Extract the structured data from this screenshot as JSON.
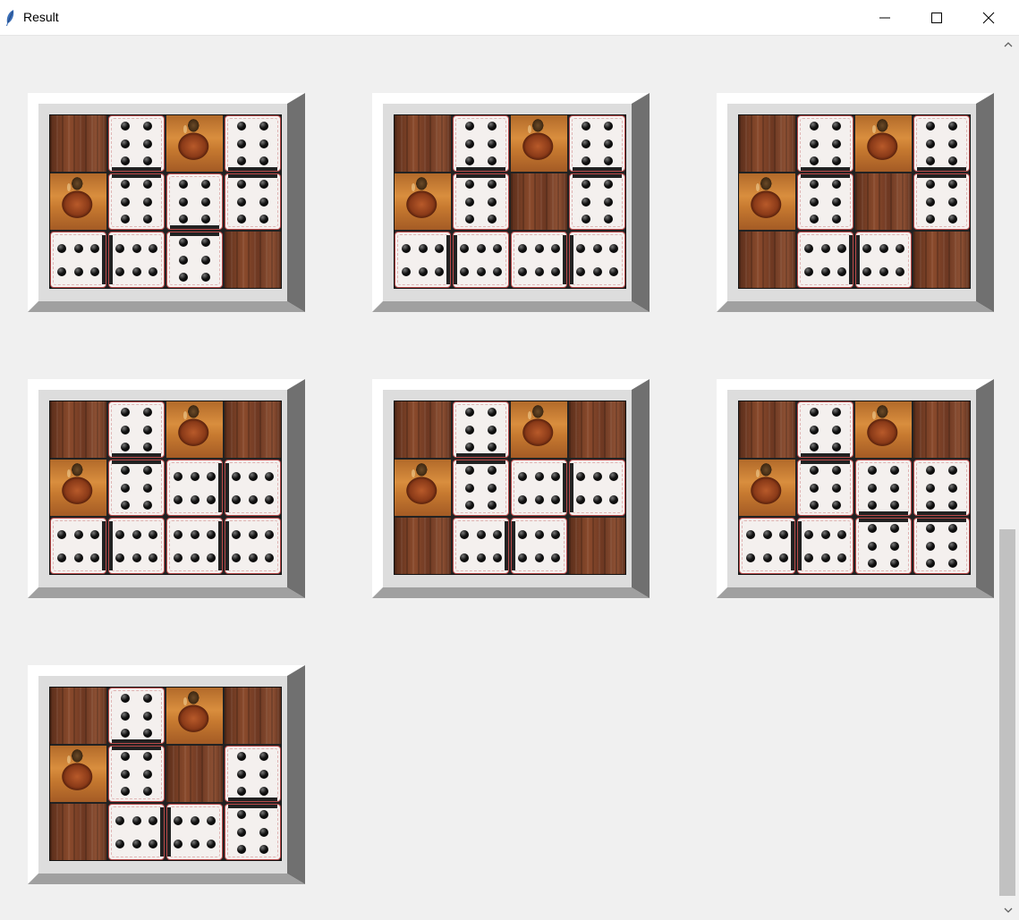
{
  "window": {
    "title": "Result",
    "app_icon": "feather-icon",
    "controls": [
      "minimize-icon",
      "maximize-icon",
      "close-icon"
    ]
  },
  "boards": [
    {
      "cells": [
        {
          "kind": "wood"
        },
        {
          "kind": "die",
          "orient": "v",
          "link": "bottom"
        },
        {
          "kind": "vase"
        },
        {
          "kind": "die",
          "orient": "v",
          "link": "bottom"
        },
        {
          "kind": "vase"
        },
        {
          "kind": "die",
          "orient": "v",
          "link": "top"
        },
        {
          "kind": "die",
          "orient": "v",
          "link": "bottom"
        },
        {
          "kind": "die",
          "orient": "v",
          "link": "top"
        },
        {
          "kind": "die",
          "orient": "h",
          "link": "right"
        },
        {
          "kind": "die",
          "orient": "h",
          "link": "left"
        },
        {
          "kind": "die",
          "orient": "v",
          "link": "top"
        },
        {
          "kind": "wood"
        }
      ]
    },
    {
      "cells": [
        {
          "kind": "wood"
        },
        {
          "kind": "die",
          "orient": "v",
          "link": "bottom"
        },
        {
          "kind": "vase"
        },
        {
          "kind": "die",
          "orient": "v",
          "link": "bottom"
        },
        {
          "kind": "vase"
        },
        {
          "kind": "die",
          "orient": "v",
          "link": "top"
        },
        {
          "kind": "wood"
        },
        {
          "kind": "die",
          "orient": "v",
          "link": "top"
        },
        {
          "kind": "die",
          "orient": "h",
          "link": "right"
        },
        {
          "kind": "die",
          "orient": "h",
          "link": "left"
        },
        {
          "kind": "die",
          "orient": "h",
          "link": "right"
        },
        {
          "kind": "die",
          "orient": "h",
          "link": "left"
        }
      ]
    },
    {
      "cells": [
        {
          "kind": "wood"
        },
        {
          "kind": "die",
          "orient": "v",
          "link": "bottom"
        },
        {
          "kind": "vase"
        },
        {
          "kind": "die",
          "orient": "v",
          "link": "bottom"
        },
        {
          "kind": "vase"
        },
        {
          "kind": "die",
          "orient": "v",
          "link": "top"
        },
        {
          "kind": "wood"
        },
        {
          "kind": "die",
          "orient": "v",
          "link": "top"
        },
        {
          "kind": "wood"
        },
        {
          "kind": "die",
          "orient": "h",
          "link": "right"
        },
        {
          "kind": "die",
          "orient": "h",
          "link": "left"
        },
        {
          "kind": "wood"
        }
      ]
    },
    {
      "cells": [
        {
          "kind": "wood"
        },
        {
          "kind": "die",
          "orient": "v",
          "link": "bottom"
        },
        {
          "kind": "vase"
        },
        {
          "kind": "wood"
        },
        {
          "kind": "vase"
        },
        {
          "kind": "die",
          "orient": "v",
          "link": "top"
        },
        {
          "kind": "die",
          "orient": "h",
          "link": "right"
        },
        {
          "kind": "die",
          "orient": "h",
          "link": "left"
        },
        {
          "kind": "die",
          "orient": "h",
          "link": "right"
        },
        {
          "kind": "die",
          "orient": "h",
          "link": "left"
        },
        {
          "kind": "die",
          "orient": "h",
          "link": "right"
        },
        {
          "kind": "die",
          "orient": "h",
          "link": "left"
        }
      ]
    },
    {
      "cells": [
        {
          "kind": "wood"
        },
        {
          "kind": "die",
          "orient": "v",
          "link": "bottom"
        },
        {
          "kind": "vase"
        },
        {
          "kind": "wood"
        },
        {
          "kind": "vase"
        },
        {
          "kind": "die",
          "orient": "v",
          "link": "top"
        },
        {
          "kind": "die",
          "orient": "h",
          "link": "right"
        },
        {
          "kind": "die",
          "orient": "h",
          "link": "left"
        },
        {
          "kind": "wood"
        },
        {
          "kind": "die",
          "orient": "h",
          "link": "right"
        },
        {
          "kind": "die",
          "orient": "h",
          "link": "left"
        },
        {
          "kind": "wood"
        }
      ]
    },
    {
      "cells": [
        {
          "kind": "wood"
        },
        {
          "kind": "die",
          "orient": "v",
          "link": "bottom"
        },
        {
          "kind": "vase"
        },
        {
          "kind": "wood"
        },
        {
          "kind": "vase"
        },
        {
          "kind": "die",
          "orient": "v",
          "link": "top"
        },
        {
          "kind": "die",
          "orient": "v",
          "link": "bottom"
        },
        {
          "kind": "die",
          "orient": "v",
          "link": "bottom"
        },
        {
          "kind": "die",
          "orient": "h",
          "link": "right"
        },
        {
          "kind": "die",
          "orient": "h",
          "link": "left"
        },
        {
          "kind": "die",
          "orient": "v",
          "link": "top"
        },
        {
          "kind": "die",
          "orient": "v",
          "link": "top"
        }
      ]
    },
    {
      "cells": [
        {
          "kind": "wood"
        },
        {
          "kind": "die",
          "orient": "v",
          "link": "bottom"
        },
        {
          "kind": "vase"
        },
        {
          "kind": "wood"
        },
        {
          "kind": "vase"
        },
        {
          "kind": "die",
          "orient": "v",
          "link": "top"
        },
        {
          "kind": "wood"
        },
        {
          "kind": "die",
          "orient": "v",
          "link": "bottom"
        },
        {
          "kind": "wood"
        },
        {
          "kind": "die",
          "orient": "h",
          "link": "right"
        },
        {
          "kind": "die",
          "orient": "h",
          "link": "left"
        },
        {
          "kind": "die",
          "orient": "v",
          "link": "top"
        }
      ]
    }
  ],
  "colors": {
    "window_bg": "#f0f0f0",
    "bevel_light": "#ffffff",
    "bevel_face": "#dddddd",
    "bevel_mid": "#a0a0a0",
    "bevel_dark": "#707070"
  }
}
